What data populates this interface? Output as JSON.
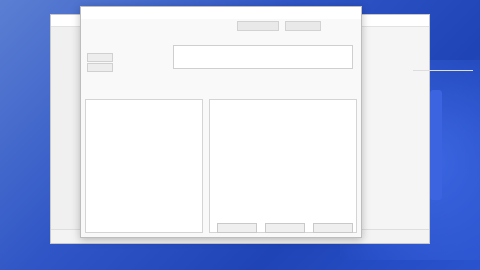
{
  "note": "",
  "background_window": {
    "title": "",
    "sidebar_items": [
      "",
      "",
      ""
    ],
    "list_header": "",
    "list_rows": [
      "",
      "",
      "",
      "",
      "",
      "",
      "",
      "",
      "",
      "",
      "",
      "",
      "",
      "",
      "",
      "",
      "",
      ""
    ],
    "status_text": ""
  },
  "dialog": {
    "title": "",
    "tab_labels": [
      "",
      ""
    ],
    "field_labels": [
      "",
      ""
    ],
    "input_value": "",
    "option_label": "",
    "left_pane_header": "",
    "right_pane_header": "",
    "paragraphs": [
      "",
      "",
      ""
    ],
    "buttons": [
      "",
      "",
      ""
    ],
    "controls": {
      "minimize": "",
      "maximize": "",
      "close": ""
    }
  }
}
